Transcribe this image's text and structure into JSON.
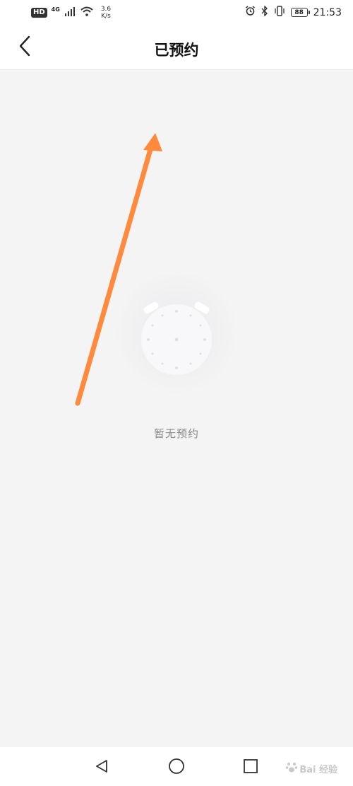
{
  "status_bar": {
    "hd": "HD",
    "network": "4G",
    "speed_value": "3.6",
    "speed_unit": "K/s",
    "battery": "88",
    "time": "21:53",
    "icons": [
      "signal-icon",
      "wifi-icon",
      "alarm-icon",
      "bluetooth-icon",
      "vibrate-icon",
      "battery-icon"
    ]
  },
  "header": {
    "title": "已预约",
    "back_icon": "chevron-left-icon"
  },
  "empty_state": {
    "icon": "alarm-clock-icon",
    "text": "暂无预约"
  },
  "annotation": {
    "type": "arrow",
    "color": "#ff8a3d"
  },
  "nav_bar": {
    "icons": [
      "triangle-back-icon",
      "circle-home-icon",
      "square-recent-icon"
    ]
  },
  "watermark": {
    "text": "Bai 经验",
    "color": "#c8c8c8"
  },
  "colors": {
    "background": "#f4f4f4",
    "header_background": "#ffffff",
    "empty_text": "#888888"
  }
}
